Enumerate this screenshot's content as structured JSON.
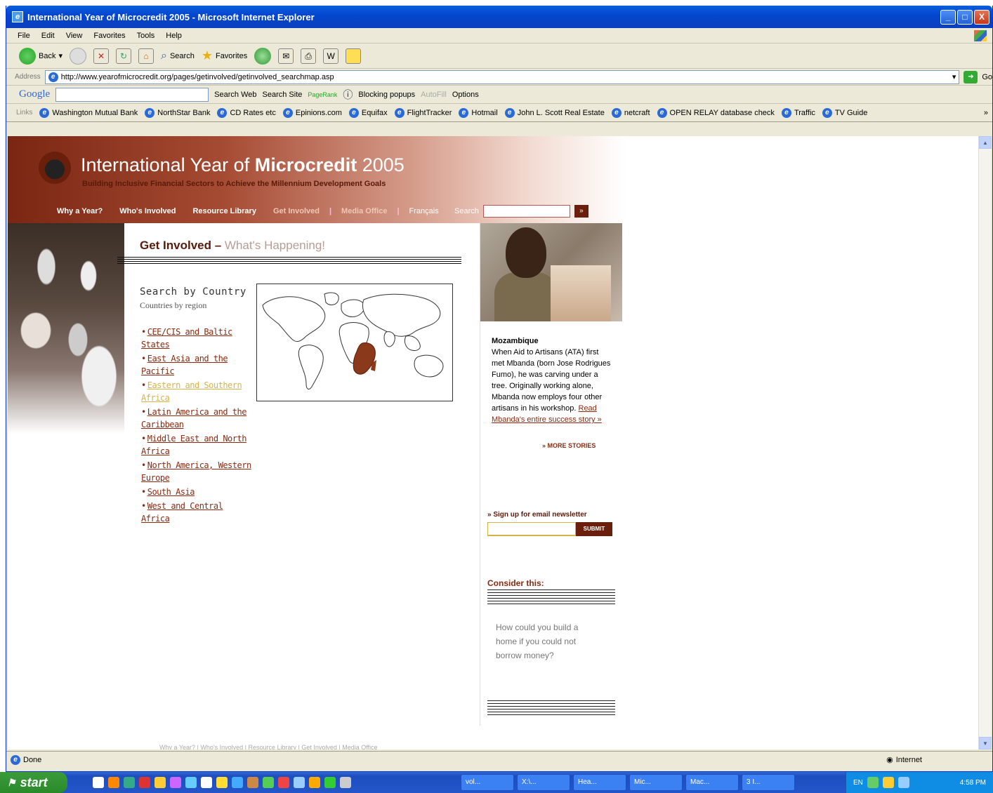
{
  "window": {
    "title": "International Year of Microcredit 2005 - Microsoft Internet Explorer",
    "min": "_",
    "max": "□",
    "close": "X"
  },
  "menu": [
    "File",
    "Edit",
    "View",
    "Favorites",
    "Tools",
    "Help"
  ],
  "toolbar": {
    "back": "Back",
    "search": "Search",
    "favorites": "Favorites"
  },
  "address": {
    "label": "Address",
    "url": "http://www.yearofmicrocredit.org/pages/getinvolved/getinvolved_searchmap.asp",
    "go": "Go"
  },
  "googlebar": {
    "logo": "Google",
    "search_web": "Search Web",
    "search_site": "Search Site",
    "pagerank": "PageRank",
    "blocking": "Blocking popups",
    "autofill": "AutoFill",
    "options": "Options"
  },
  "links": {
    "label": "Links",
    "items": [
      "Washington Mutual Bank",
      "NorthStar Bank",
      "CD Rates etc",
      "Epinions.com",
      "Equifax",
      "FlightTracker",
      "Hotmail",
      "John L. Scott Real Estate",
      "netcraft",
      "OPEN RELAY database check",
      "Traffic",
      "TV Guide"
    ],
    "more": "»"
  },
  "site": {
    "title_pre": "International Year of ",
    "title_bold": "Microcredit",
    "title_post": " 2005",
    "tagline": "Building Inclusive Financial Sectors to Achieve the Millennium Development Goals",
    "nav": [
      "Why a Year?",
      "Who's Involved",
      "Resource Library",
      "Get Involved",
      "Media Office",
      "Français"
    ],
    "search_label": "Search",
    "search_go": "»"
  },
  "main": {
    "heading": "Get Involved –",
    "subheading": " What's Happening!",
    "search_title": "Search by Country",
    "search_sub": "Countries by region",
    "regions": [
      "CEE/CIS and Baltic States",
      "East Asia and the Pacific",
      "Eastern and Southern Africa",
      "Latin America and the Caribbean",
      "Middle East and North Africa",
      "North America, Western Europe",
      "South Asia",
      "West and Central Africa"
    ],
    "active_region": 2
  },
  "story": {
    "country": "Mozambique",
    "text": "When Aid to Artisans (ATA) first met Mbanda (born Jose Rodrigues Fumo), he was carving under a tree. Originally working alone, Mbanda now employs four other artisans in his workshop. ",
    "link": "Read Mbanda's entire success story »",
    "more": "» MORE STORIES"
  },
  "newsletter": {
    "label": "» Sign up for email newsletter",
    "submit": "SUBMIT"
  },
  "consider": {
    "label": "Consider this:",
    "text": "How could you build a home if you could not borrow money?"
  },
  "footer": "Why a Year? | Who's Involved | Resource Library | Get Involved | Media Office",
  "status": {
    "text": "Done",
    "zone": "Internet"
  },
  "taskbar": {
    "start": "start",
    "tasks": [
      "vol...",
      "X:\\...",
      "Hea...",
      "Mic...",
      "Mac...",
      "3 I..."
    ],
    "lang": "EN",
    "clock": "4:58 PM"
  },
  "colors": {
    "brand": "#7a2612",
    "accent": "#d6b34a",
    "link": "#8a2a10"
  }
}
